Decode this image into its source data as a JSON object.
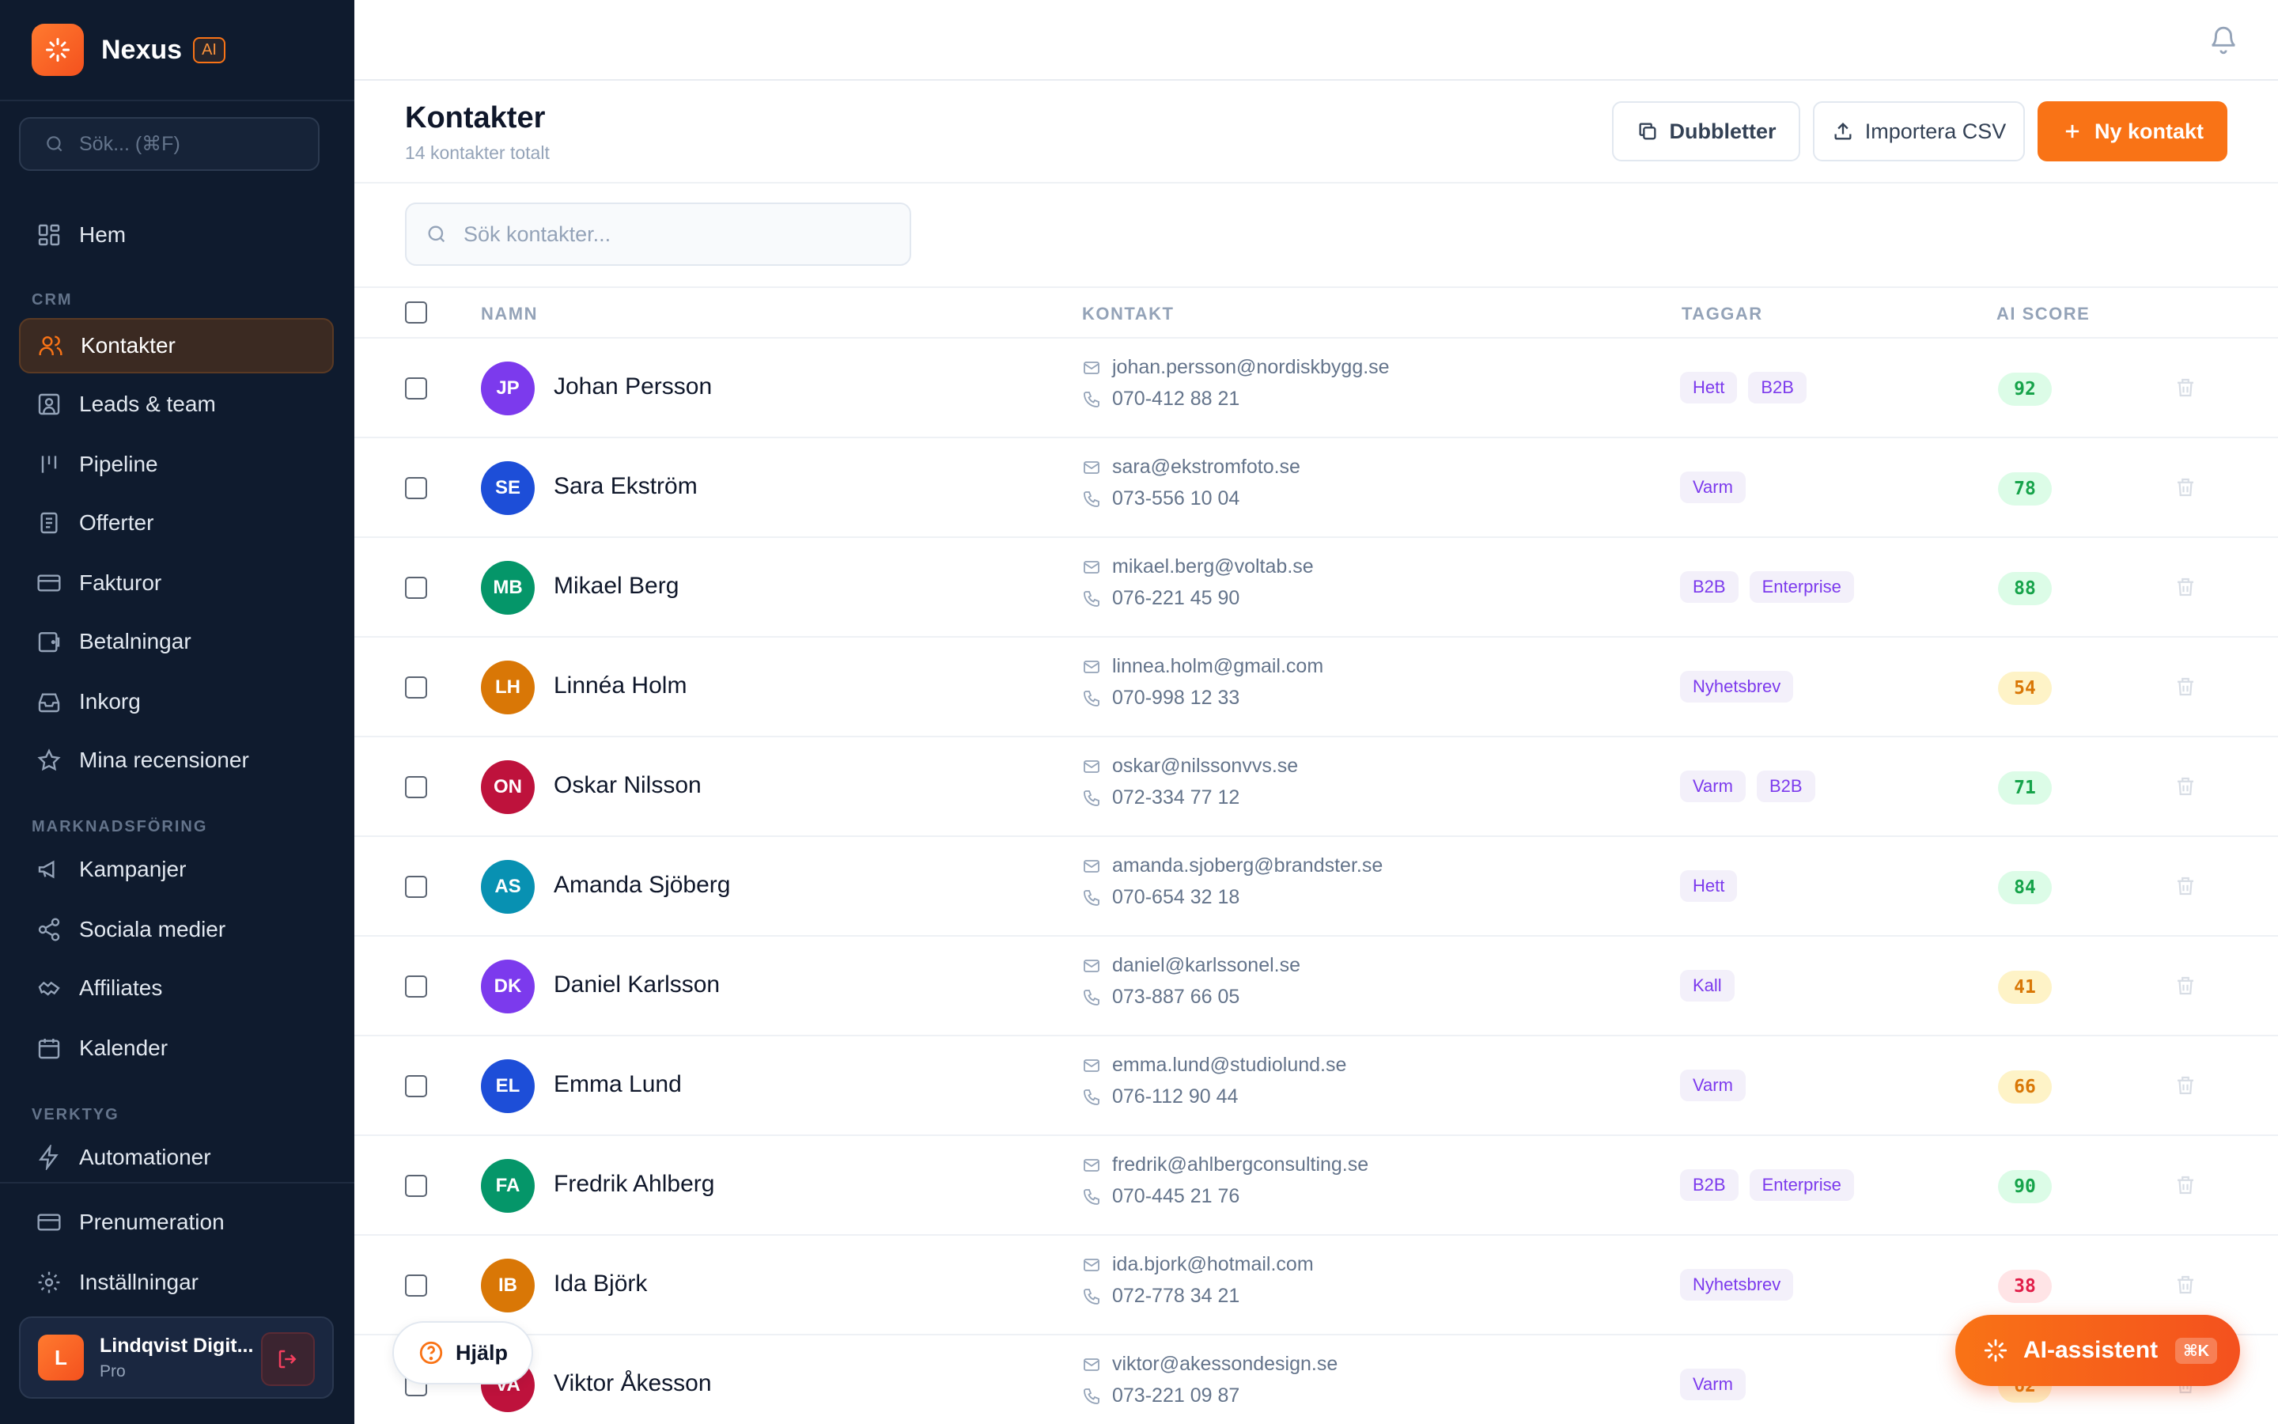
{
  "app": {
    "name": "Nexus",
    "badge": "AI"
  },
  "sidebar": {
    "search_placeholder": "Sök... (⌘F)",
    "top_items": [
      {
        "label": "Hem",
        "icon": "dashboard-icon"
      }
    ],
    "sections": [
      {
        "title": "CRM",
        "items": [
          {
            "label": "Kontakter",
            "icon": "users-icon",
            "active": true
          },
          {
            "label": "Leads & team",
            "icon": "contact-card-icon"
          },
          {
            "label": "Pipeline",
            "icon": "pipeline-icon"
          },
          {
            "label": "Offerter",
            "icon": "document-icon"
          },
          {
            "label": "Fakturor",
            "icon": "credit-card-icon"
          },
          {
            "label": "Betalningar",
            "icon": "wallet-icon"
          },
          {
            "label": "Inkorg",
            "icon": "inbox-icon"
          },
          {
            "label": "Mina recensioner",
            "icon": "star-icon"
          }
        ]
      },
      {
        "title": "MARKNADSFÖRING",
        "items": [
          {
            "label": "Kampanjer",
            "icon": "megaphone-icon"
          },
          {
            "label": "Sociala medier",
            "icon": "share-icon"
          },
          {
            "label": "Affiliates",
            "icon": "handshake-icon"
          },
          {
            "label": "Kalender",
            "icon": "calendar-icon"
          }
        ]
      },
      {
        "title": "VERKTYG",
        "items": [
          {
            "label": "Automationer",
            "icon": "lightning-icon"
          }
        ]
      }
    ],
    "bottom_items": [
      {
        "label": "Prenumeration",
        "icon": "credit-card-icon"
      },
      {
        "label": "Inställningar",
        "icon": "gear-icon"
      }
    ],
    "account": {
      "initial": "L",
      "name": "Lindqvist Digit...",
      "plan": "Pro"
    }
  },
  "page": {
    "title": "Kontakter",
    "subtitle": "14 kontakter totalt",
    "buttons": {
      "duplicates": "Dubbletter",
      "import": "Importera CSV",
      "new_contact": "Ny kontakt"
    },
    "search_placeholder": "Sök kontakter..."
  },
  "table": {
    "columns": {
      "name": "NAMN",
      "contact": "KONTAKT",
      "tags": "TAGGAR",
      "score": "AI SCORE"
    },
    "rows": [
      {
        "initials": "JP",
        "name": "Johan Persson",
        "email": "johan.persson@nordiskbygg.se",
        "phone": "070-412 88 21",
        "tags": [
          "Hett",
          "B2B"
        ],
        "score": "92",
        "avatar_color": "#7c3aed"
      },
      {
        "initials": "SE",
        "name": "Sara Ekström",
        "email": "sara@ekstromfoto.se",
        "phone": "073-556 10 04",
        "tags": [
          "Varm"
        ],
        "score": "78",
        "avatar_color": "#1d4ed8"
      },
      {
        "initials": "MB",
        "name": "Mikael Berg",
        "email": "mikael.berg@voltab.se",
        "phone": "076-221 45 90",
        "tags": [
          "B2B",
          "Enterprise"
        ],
        "score": "88",
        "avatar_color": "#059669"
      },
      {
        "initials": "LH",
        "name": "Linnéa Holm",
        "email": "linnea.holm@gmail.com",
        "phone": "070-998 12 33",
        "tags": [
          "Nyhetsbrev"
        ],
        "score": "54",
        "avatar_color": "#d97706"
      },
      {
        "initials": "ON",
        "name": "Oskar Nilsson",
        "email": "oskar@nilssonvvs.se",
        "phone": "072-334 77 12",
        "tags": [
          "Varm",
          "B2B"
        ],
        "score": "71",
        "avatar_color": "#be123c"
      },
      {
        "initials": "AS",
        "name": "Amanda Sjöberg",
        "email": "amanda.sjoberg@brandster.se",
        "phone": "070-654 32 18",
        "tags": [
          "Hett"
        ],
        "score": "84",
        "avatar_color": "#0891b2"
      },
      {
        "initials": "DK",
        "name": "Daniel Karlsson",
        "email": "daniel@karlssonel.se",
        "phone": "073-887 66 05",
        "tags": [
          "Kall"
        ],
        "score": "41",
        "avatar_color": "#7c3aed"
      },
      {
        "initials": "EL",
        "name": "Emma Lund",
        "email": "emma.lund@studiolund.se",
        "phone": "076-112 90 44",
        "tags": [
          "Varm"
        ],
        "score": "66",
        "avatar_color": "#1d4ed8"
      },
      {
        "initials": "FA",
        "name": "Fredrik Ahlberg",
        "email": "fredrik@ahlbergconsulting.se",
        "phone": "070-445 21 76",
        "tags": [
          "B2B",
          "Enterprise"
        ],
        "score": "90",
        "avatar_color": "#059669"
      },
      {
        "initials": "IB",
        "name": "Ida Björk",
        "email": "ida.bjork@hotmail.com",
        "phone": "072-778 34 21",
        "tags": [
          "Nyhetsbrev"
        ],
        "score": "38",
        "avatar_color": "#d97706"
      },
      {
        "initials": "VA",
        "name": "Viktor Åkesson",
        "email": "viktor@akessondesign.se",
        "phone": "073-221 09 87",
        "tags": [
          "Varm"
        ],
        "score": "62",
        "avatar_color": "#be123c"
      }
    ]
  },
  "help_label": "Hjälp",
  "ai_assistant": {
    "label": "AI-assistent",
    "shortcut": "⌘K"
  },
  "colors": {
    "accent": "#f97316",
    "sidebar_bg": "#0f1b2e",
    "score_high": "#dcfce7",
    "score_mid": "#fef3c7",
    "score_low": "#ffe4e6"
  }
}
